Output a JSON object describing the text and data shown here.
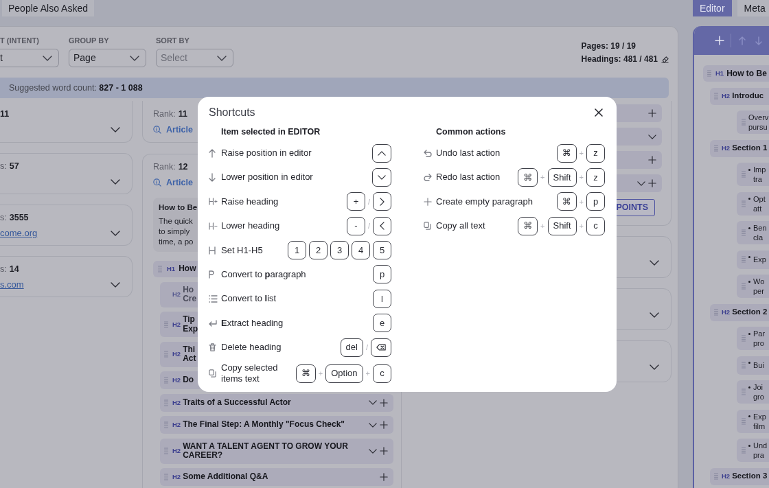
{
  "left_tabs": [
    {
      "label": "People Also Asked",
      "selected": false
    }
  ],
  "filters": [
    {
      "label": "T (INTENT)",
      "value": "t"
    },
    {
      "label": "GROUP BY",
      "value": "Page"
    },
    {
      "label": "SORT BY",
      "placeholder": "Select"
    }
  ],
  "stats": [
    "Pages: 19 / 19",
    "Headings: 481 / 481"
  ],
  "word_count": "Suggested word count: **827 - 1 088**",
  "column_1": [
    {
      "value": "11"
    },
    {
      "label": "s:",
      "value": "57"
    },
    {
      "label": "s:",
      "value": "3555",
      "link": "come.org"
    },
    {
      "label": "s:",
      "value": "14",
      "link": "s.com"
    }
  ],
  "column_2": [
    {
      "label": "Rank:",
      "value": "11",
      "type": "Article"
    },
    {
      "label": "Rank:",
      "value": "12",
      "type": "Article",
      "snippet": {
        "title": "How to Be",
        "body": "The quick\nto simply\ntime, a po"
      },
      "outline": [
        {
          "level": "H1",
          "text": "How",
          "disabled": false,
          "children": [
            {
              "level": "H2",
              "text": "Ho\nCre",
              "disabled": true
            },
            {
              "level": "H2",
              "text": "Tip\nExp",
              "disabled": false
            },
            {
              "level": "H2",
              "text": "Thi\nAct",
              "disabled": false
            },
            {
              "level": "H2",
              "text": "Do",
              "disabled": false
            },
            {
              "level": "H2",
              "text": "Traits of a Successful Actor",
              "disabled": false,
              "toggle": true,
              "add": true
            },
            {
              "level": "H2",
              "text": "The Final Step: A Monthly \"Focus Check\"",
              "disabled": false,
              "toggle": true,
              "add": true
            },
            {
              "level": "H2",
              "text": "WANT A TALENT AGENT TO GROW YOUR CAREER?",
              "disabled": false,
              "toggle": true,
              "add": true
            },
            {
              "level": "H2",
              "text": "Some Additional Q&A",
              "disabled": false,
              "toggle": false,
              "add": true
            }
          ]
        }
      ]
    }
  ],
  "column_3": {
    "rows": [
      {
        "toggle": false,
        "add": true
      },
      {
        "toggle": true,
        "add": false
      },
      {
        "toggle": false,
        "add": true
      },
      {
        "toggle": true,
        "add": true
      }
    ],
    "button": "POINTS",
    "cards": [
      {
        "toggle": true
      },
      {
        "toggle": true
      },
      {
        "toggle": true
      }
    ]
  },
  "right_tabs": [
    {
      "label": "Editor",
      "selected": true
    },
    {
      "label": "Meta",
      "selected": false
    }
  ],
  "editor": {
    "toolbar": [
      {
        "disabled": false
      },
      {
        "disabled": true
      },
      {
        "disabled": true
      }
    ],
    "outline": [
      {
        "level": "H1",
        "text": "How to Be",
        "children": [
          {
            "level": "H2",
            "text": "Introduc",
            "children": [
              {
                "kind": "paragraph",
                "text": "Overv\npursu"
              }
            ]
          },
          {
            "level": "H2",
            "text": "Section 1",
            "children": [
              {
                "kind": "bullet",
                "text": "Imp\ntra"
              },
              {
                "kind": "bullet",
                "text": "Opt\natt"
              },
              {
                "kind": "bullet",
                "text": "Ben\ncla"
              },
              {
                "kind": "bullet",
                "text": "Exp"
              },
              {
                "kind": "bullet",
                "text": "Wo\nper"
              }
            ]
          },
          {
            "level": "H2",
            "text": "Section 2",
            "children": [
              {
                "kind": "bullet",
                "text": "Par\npro"
              },
              {
                "kind": "bullet",
                "text": "Bui"
              },
              {
                "kind": "bullet",
                "text": "Joi\ngro"
              },
              {
                "kind": "bullet",
                "text": "Exp\nfilm"
              },
              {
                "kind": "bullet",
                "text": "Und\npra"
              }
            ]
          },
          {
            "level": "H2",
            "text": "Section 3"
          }
        ]
      }
    ]
  },
  "shortcuts": {
    "title": "Shortcuts",
    "groups": [
      {
        "title": "Item selected in EDITOR",
        "items": [
          {
            "label": "Raise position in editor",
            "keys": [
              {
                "kind": "up"
              }
            ]
          },
          {
            "label": "Lower position in editor",
            "keys": [
              {
                "kind": "down"
              }
            ]
          },
          {
            "label": "Raise heading",
            "keys": [
              {
                "kind": "key",
                "label": "+"
              },
              {
                "kind": "sep",
                "label": "/"
              },
              {
                "kind": "right"
              }
            ]
          },
          {
            "label": "Lower heading",
            "keys": [
              {
                "kind": "key",
                "label": "-"
              },
              {
                "kind": "sep",
                "label": "/"
              },
              {
                "kind": "left"
              }
            ]
          },
          {
            "label": "Set H1-H5",
            "keys": [
              {
                "kind": "key",
                "label": "1"
              },
              {
                "kind": "key",
                "label": "2"
              },
              {
                "kind": "key",
                "label": "3"
              },
              {
                "kind": "key",
                "label": "4"
              },
              {
                "kind": "key",
                "label": "5"
              }
            ]
          },
          {
            "label": "Convert to **p**aragraph",
            "keys": [
              {
                "kind": "key",
                "label": "p"
              }
            ]
          },
          {
            "label": "Convert to **l**ist",
            "keys": [
              {
                "kind": "key",
                "label": "l"
              }
            ]
          },
          {
            "label": "**E**xtract heading",
            "keys": [
              {
                "kind": "key",
                "label": "e"
              }
            ]
          },
          {
            "label": "Delete heading",
            "keys": [
              {
                "kind": "key",
                "label": "del"
              },
              {
                "kind": "sep",
                "label": "/"
              },
              {
                "kind": "backspace"
              }
            ]
          },
          {
            "label": "Copy selected items text",
            "keys": [
              {
                "kind": "key",
                "label": "⌘"
              },
              {
                "kind": "sep",
                "label": "+"
              },
              {
                "kind": "key",
                "label": "Option"
              },
              {
                "kind": "sep",
                "label": "+"
              },
              {
                "kind": "key",
                "label": "c"
              }
            ]
          }
        ]
      },
      {
        "title": "Common actions",
        "items": [
          {
            "label": "Undo last action",
            "keys": [
              {
                "kind": "key",
                "label": "⌘"
              },
              {
                "kind": "sep",
                "label": "+"
              },
              {
                "kind": "key",
                "label": "z"
              }
            ]
          },
          {
            "label": "Redo last action",
            "keys": [
              {
                "kind": "key",
                "label": "⌘"
              },
              {
                "kind": "sep",
                "label": "+"
              },
              {
                "kind": "key",
                "label": "Shift"
              },
              {
                "kind": "sep",
                "label": "+"
              },
              {
                "kind": "key",
                "label": "z"
              }
            ]
          },
          {
            "label": "Create empty paragraph",
            "keys": [
              {
                "kind": "key",
                "label": "⌘"
              },
              {
                "kind": "sep",
                "label": "+"
              },
              {
                "kind": "key",
                "label": "p"
              }
            ]
          },
          {
            "label": "Copy all text",
            "keys": [
              {
                "kind": "key",
                "label": "⌘"
              },
              {
                "kind": "sep",
                "label": "+"
              },
              {
                "kind": "key",
                "label": "Shift"
              },
              {
                "kind": "sep",
                "label": "+"
              },
              {
                "kind": "key",
                "label": "c"
              }
            ]
          }
        ]
      }
    ]
  }
}
